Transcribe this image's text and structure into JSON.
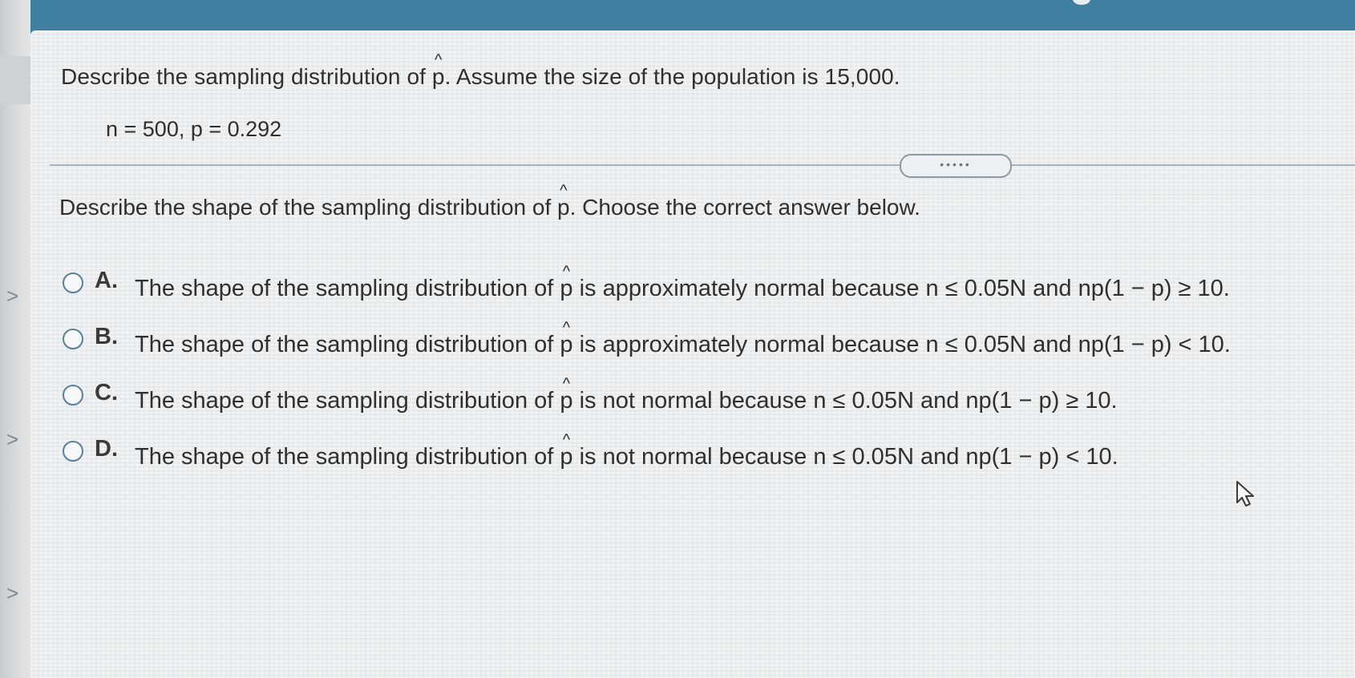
{
  "question": {
    "prefix": "Describe the sampling distribution of ",
    "symbol": "p",
    "hat": "^",
    "suffix": ". Assume the size of the population is 15,000."
  },
  "params": "n = 500, p = 0.292",
  "divider_handle": "•••••",
  "instruction": {
    "prefix": "Describe the shape of the sampling distribution of ",
    "symbol": "p",
    "hat": "^",
    "suffix": ". Choose the correct answer below."
  },
  "options": [
    {
      "letter": "A.",
      "prefix": "The shape of the sampling distribution of ",
      "symbol": "p",
      "hat": "^",
      "suffix": " is approximately normal because n ≤ 0.05N and np(1 − p) ≥ 10."
    },
    {
      "letter": "B.",
      "prefix": "The shape of the sampling distribution of ",
      "symbol": "p",
      "hat": "^",
      "suffix": " is approximately normal because n ≤ 0.05N and np(1 − p) < 10."
    },
    {
      "letter": "C.",
      "prefix": "The shape of the sampling distribution of ",
      "symbol": "p",
      "hat": "^",
      "suffix": " is not normal because n ≤ 0.05N and np(1 − p) ≥ 10."
    },
    {
      "letter": "D.",
      "prefix": "The shape of the sampling distribution of ",
      "symbol": "p",
      "hat": "^",
      "suffix": " is not normal because n ≤ 0.05N and np(1 − p) < 10."
    }
  ],
  "left_nav_glyph": ">",
  "colors": {
    "header": "#3f7fa0",
    "radio_border": "#5b7f99"
  },
  "icons": {
    "cursor": "mouse-pointer-icon",
    "nav": "chevron-right-icon"
  }
}
